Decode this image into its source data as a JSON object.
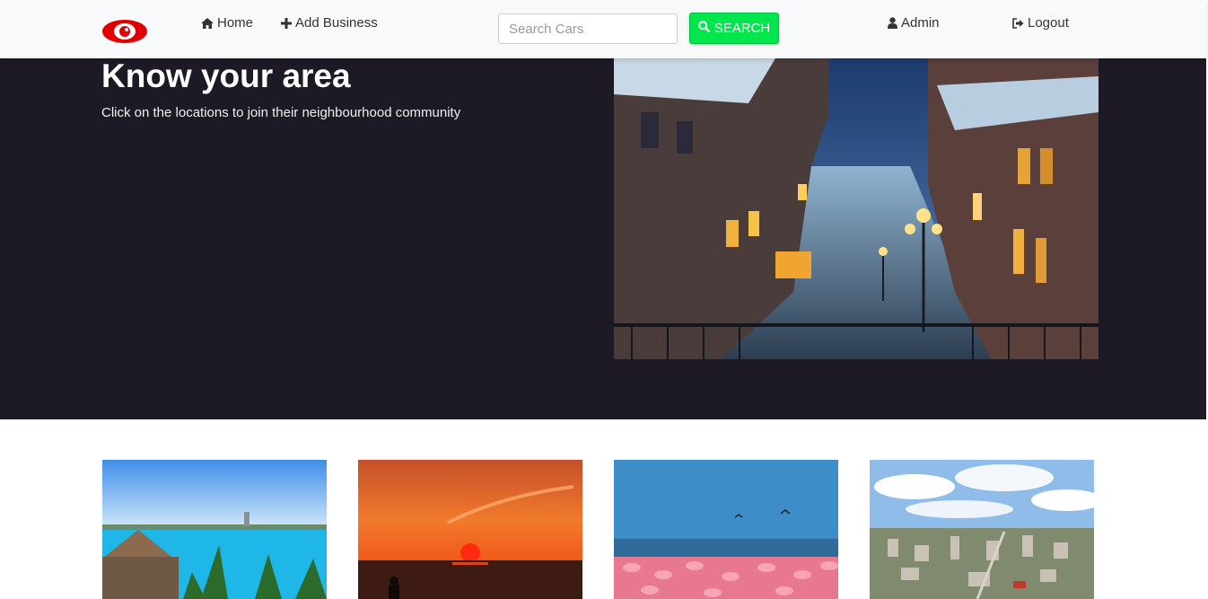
{
  "nav": {
    "home": "Home",
    "add_business": "Add Business",
    "admin": "Admin",
    "logout": "Logout"
  },
  "search": {
    "placeholder": "Search Cars",
    "button": "SEARCH"
  },
  "hero": {
    "title": "Know your area",
    "subtitle": "Click on the locations to join their neighbourhood community"
  },
  "colors": {
    "accent": "#00e64d",
    "logo_red": "#e00000",
    "hero_bg": "#1d1a26"
  },
  "icons": {
    "home": "home-icon",
    "add": "plus-icon",
    "search": "search-icon",
    "admin": "user-icon",
    "logout": "sign-out-icon"
  }
}
